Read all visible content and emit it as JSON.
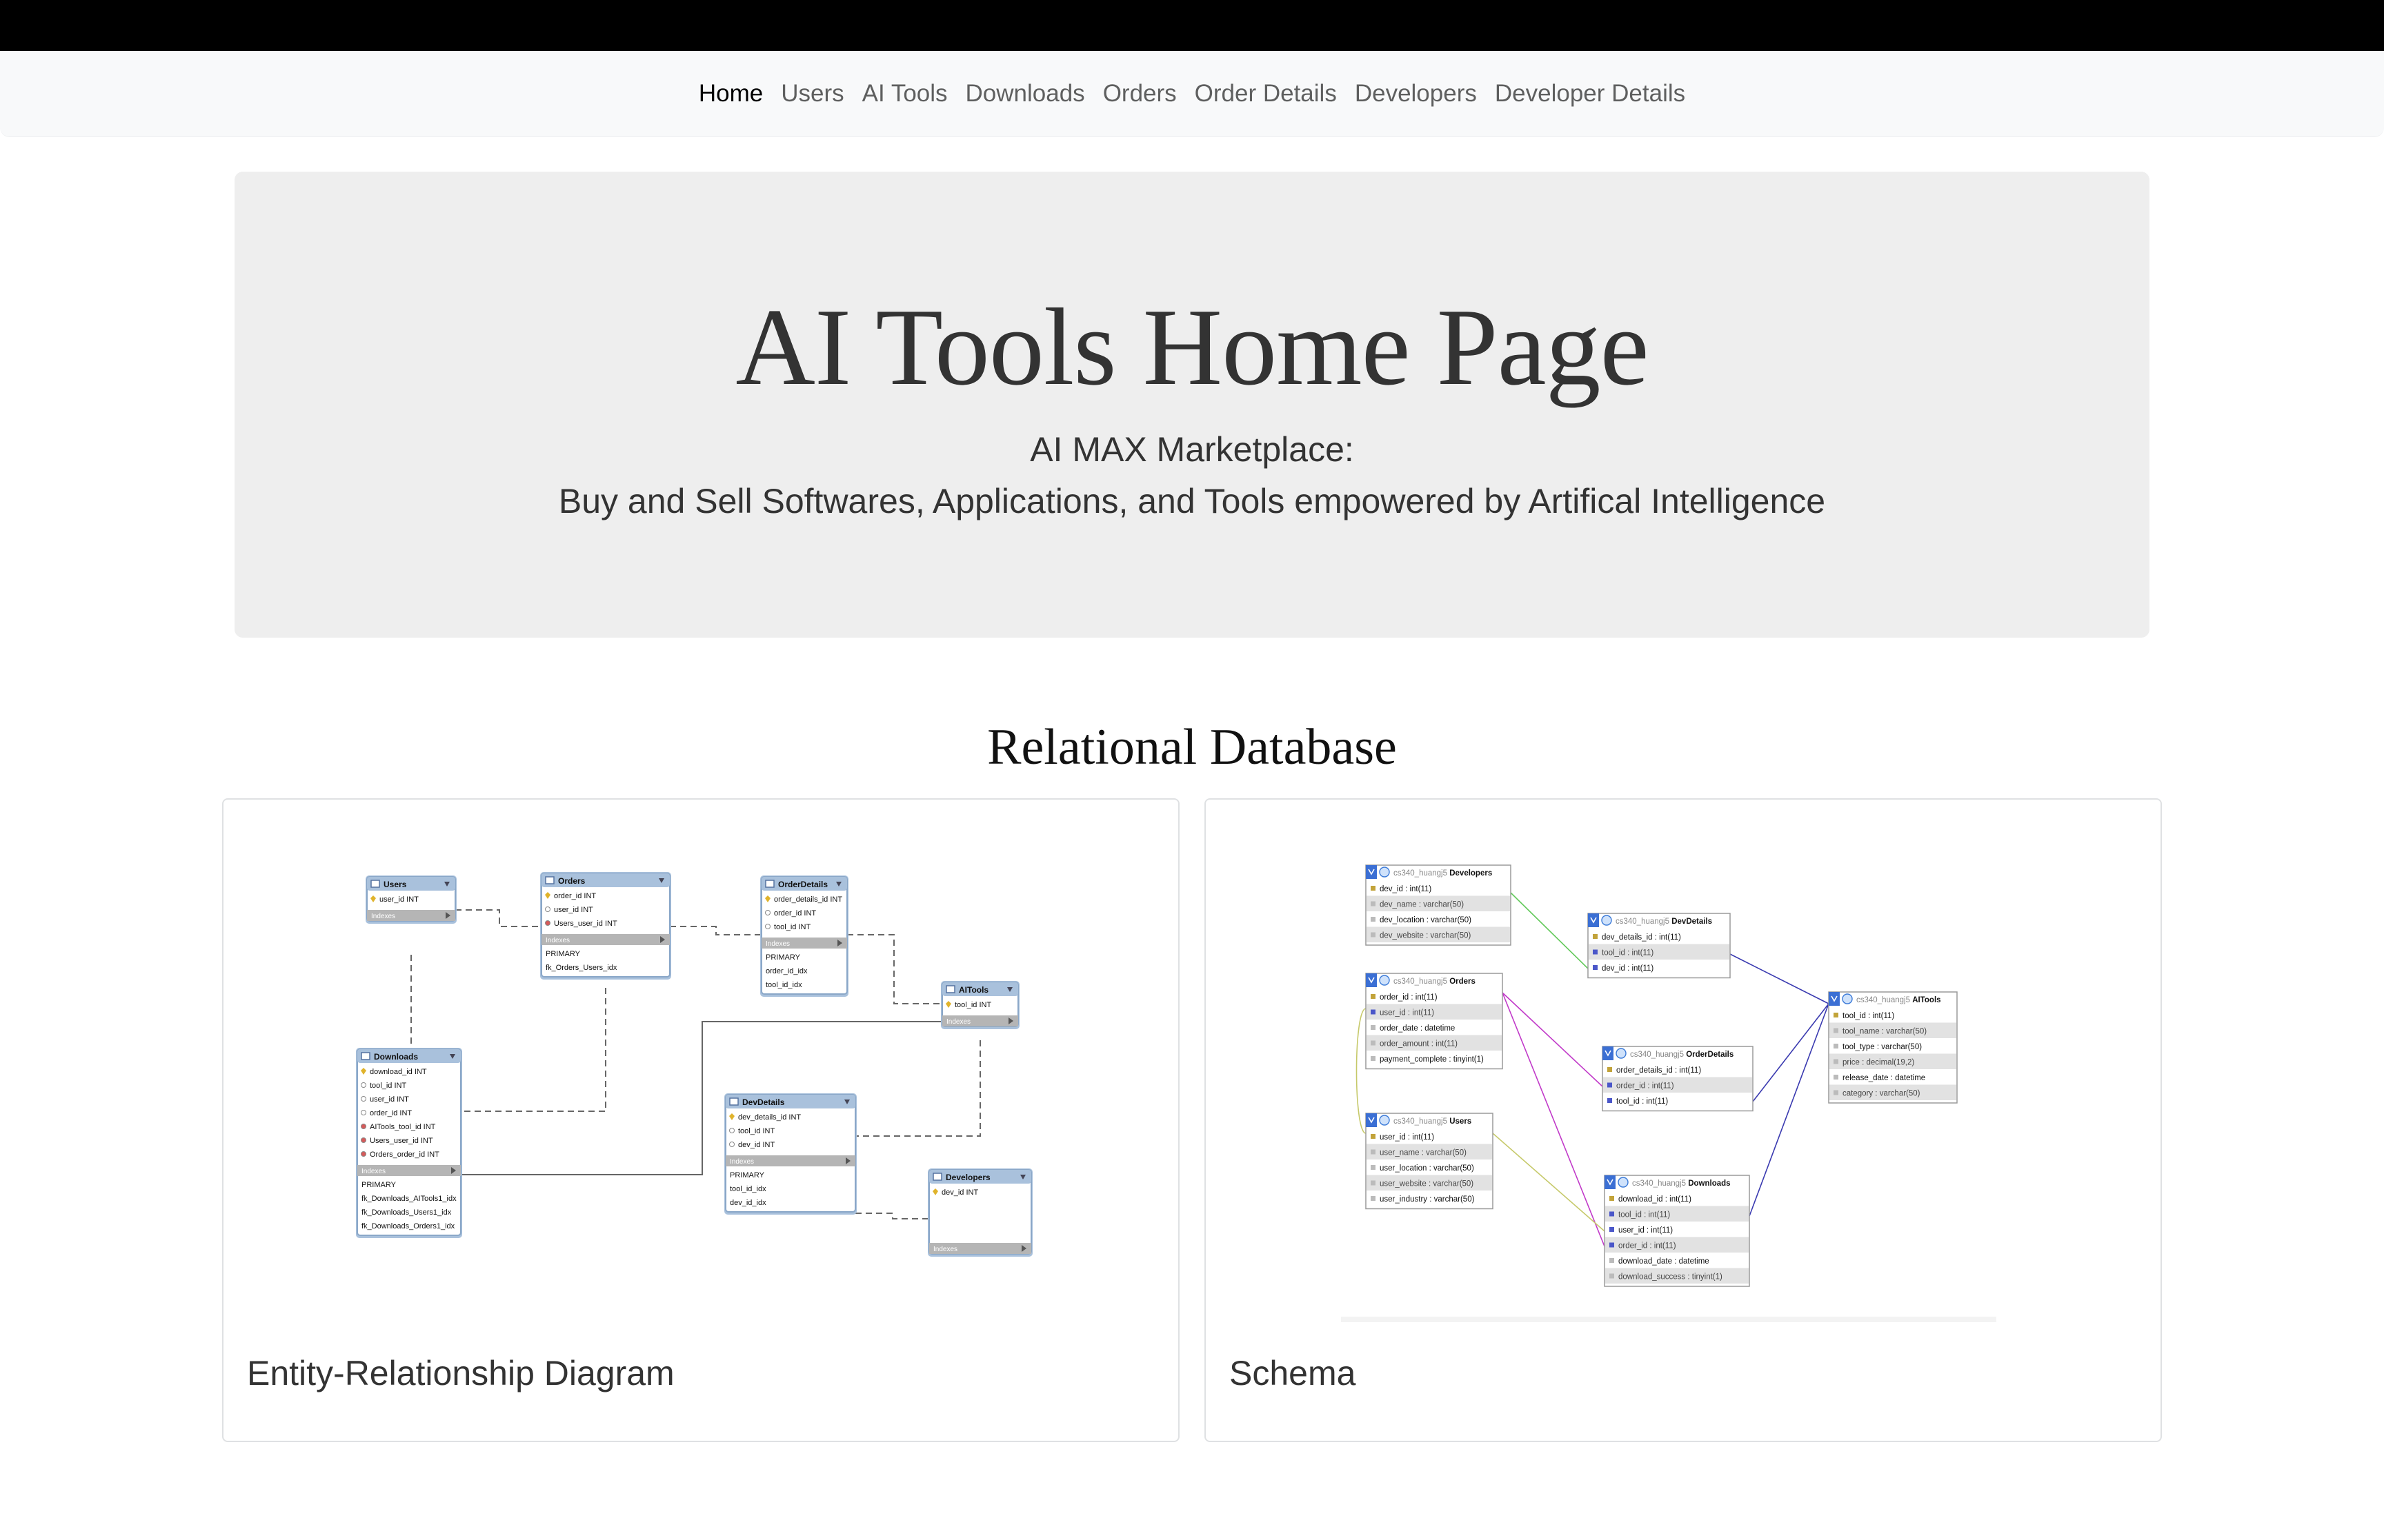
{
  "nav": {
    "items": [
      {
        "label": "Home",
        "active": true
      },
      {
        "label": "Users"
      },
      {
        "label": "AI Tools"
      },
      {
        "label": "Downloads"
      },
      {
        "label": "Orders"
      },
      {
        "label": "Order Details"
      },
      {
        "label": "Developers"
      },
      {
        "label": "Developer Details"
      }
    ]
  },
  "hero": {
    "title": "AI Tools Home Page",
    "subtitle_line1": "AI MAX Marketplace:",
    "subtitle_line2": "Buy and Sell Softwares, Applications, and Tools empowered by Artifical Intelligence"
  },
  "section": {
    "title": "Relational Database"
  },
  "cards": [
    {
      "caption": "Entity-Relationship Diagram"
    },
    {
      "caption": "Schema"
    }
  ],
  "er_diagram": {
    "indexes_label": "Indexes",
    "tables": {
      "users": {
        "name": "Users",
        "cols": [
          "user_id INT"
        ],
        "idx": []
      },
      "orders": {
        "name": "Orders",
        "cols": [
          "order_id INT",
          "user_id INT",
          "Users_user_id INT"
        ],
        "idx": [
          "PRIMARY",
          "fk_Orders_Users_idx"
        ]
      },
      "orderdetails": {
        "name": "OrderDetails",
        "cols": [
          "order_details_id INT",
          "order_id INT",
          "tool_id INT"
        ],
        "idx": [
          "PRIMARY",
          "order_id_idx",
          "tool_id_idx"
        ]
      },
      "aitools": {
        "name": "AITools",
        "cols": [
          "tool_id INT"
        ],
        "idx": []
      },
      "downloads": {
        "name": "Downloads",
        "cols": [
          "download_id INT",
          "tool_id INT",
          "user_id INT",
          "order_id INT",
          "AITools_tool_id INT",
          "Users_user_id INT",
          "Orders_order_id INT"
        ],
        "idx": [
          "PRIMARY",
          "fk_Downloads_AITools1_idx",
          "fk_Downloads_Users1_idx",
          "fk_Downloads_Orders1_idx"
        ]
      },
      "devdetails": {
        "name": "DevDetails",
        "cols": [
          "dev_details_id INT",
          "tool_id INT",
          "dev_id INT"
        ],
        "idx": [
          "PRIMARY",
          "tool_id_idx",
          "dev_id_idx"
        ]
      },
      "developers": {
        "name": "Developers",
        "cols": [
          "dev_id INT"
        ],
        "idx": []
      }
    }
  },
  "schema_diagram": {
    "schema_name": "cs340_huangj5",
    "tables": {
      "developers": {
        "name": "Developers",
        "cols": [
          "dev_id : int(11)",
          "dev_name : varchar(50)",
          "dev_location : varchar(50)",
          "dev_website : varchar(50)"
        ]
      },
      "devdetails": {
        "name": "DevDetails",
        "cols": [
          "dev_details_id : int(11)",
          "tool_id : int(11)",
          "dev_id : int(11)"
        ]
      },
      "orders": {
        "name": "Orders",
        "cols": [
          "order_id : int(11)",
          "user_id : int(11)",
          "order_date : datetime",
          "order_amount : int(11)",
          "payment_complete : tinyint(1)"
        ]
      },
      "aitools": {
        "name": "AITools",
        "cols": [
          "tool_id : int(11)",
          "tool_name : varchar(50)",
          "tool_type : varchar(50)",
          "price : decimal(19,2)",
          "release_date : datetime",
          "category : varchar(50)"
        ]
      },
      "orderdetails": {
        "name": "OrderDetails",
        "cols": [
          "order_details_id : int(11)",
          "order_id : int(11)",
          "tool_id : int(11)"
        ]
      },
      "users": {
        "name": "Users",
        "cols": [
          "user_id : int(11)",
          "user_name : varchar(50)",
          "user_location : varchar(50)",
          "user_website : varchar(50)",
          "user_industry : varchar(50)"
        ]
      },
      "downloads": {
        "name": "Downloads",
        "cols": [
          "download_id : int(11)",
          "tool_id : int(11)",
          "user_id : int(11)",
          "order_id : int(11)",
          "download_date : datetime",
          "download_success : tinyint(1)"
        ]
      }
    }
  }
}
